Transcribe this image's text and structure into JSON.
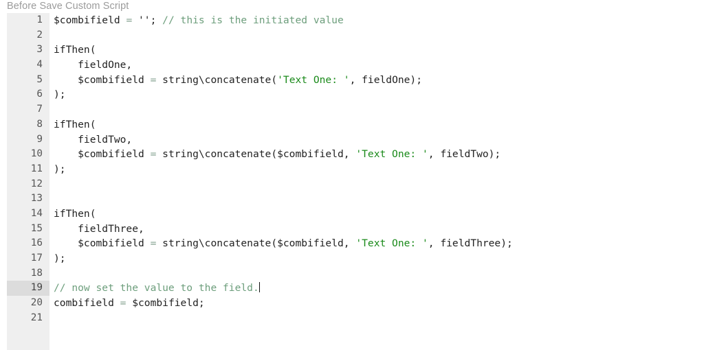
{
  "panel": {
    "title": "Before Save Custom Script"
  },
  "toolbar": {
    "add_label": "+",
    "add_icon": "plus-icon"
  },
  "editor": {
    "active_line": 19,
    "total_lines": 21,
    "colors": {
      "background": "#ffffff",
      "gutter": "#efefef",
      "gutter_active": "#dcdcdc",
      "text": "#222222",
      "comment": "#6d9e7c",
      "string": "#1a8a1a",
      "operator": "#7f9e8b",
      "title": "#9b9b9b"
    },
    "lines": [
      {
        "n": "1",
        "tokens": [
          {
            "t": "plain",
            "v": "$combifield "
          },
          {
            "t": "op",
            "v": "="
          },
          {
            "t": "plain",
            "v": " ''; "
          },
          {
            "t": "comment",
            "v": "// this is the initiated value"
          }
        ]
      },
      {
        "n": "2",
        "tokens": []
      },
      {
        "n": "3",
        "tokens": [
          {
            "t": "plain",
            "v": "ifThen("
          }
        ]
      },
      {
        "n": "4",
        "tokens": [
          {
            "t": "plain",
            "v": "    fieldOne,"
          }
        ]
      },
      {
        "n": "5",
        "tokens": [
          {
            "t": "plain",
            "v": "    $combifield "
          },
          {
            "t": "op",
            "v": "="
          },
          {
            "t": "plain",
            "v": " string\\concatenate("
          },
          {
            "t": "string",
            "v": "'Text One: '"
          },
          {
            "t": "plain",
            "v": ", fieldOne);"
          }
        ]
      },
      {
        "n": "6",
        "tokens": [
          {
            "t": "plain",
            "v": ");"
          }
        ]
      },
      {
        "n": "7",
        "tokens": []
      },
      {
        "n": "8",
        "tokens": [
          {
            "t": "plain",
            "v": "ifThen("
          }
        ]
      },
      {
        "n": "9",
        "tokens": [
          {
            "t": "plain",
            "v": "    fieldTwo,"
          }
        ]
      },
      {
        "n": "10",
        "tokens": [
          {
            "t": "plain",
            "v": "    $combifield "
          },
          {
            "t": "op",
            "v": "="
          },
          {
            "t": "plain",
            "v": " string\\concatenate($combifield, "
          },
          {
            "t": "string",
            "v": "'Text One: '"
          },
          {
            "t": "plain",
            "v": ", fieldTwo);"
          }
        ]
      },
      {
        "n": "11",
        "tokens": [
          {
            "t": "plain",
            "v": ");"
          }
        ]
      },
      {
        "n": "12",
        "tokens": []
      },
      {
        "n": "13",
        "tokens": []
      },
      {
        "n": "14",
        "tokens": [
          {
            "t": "plain",
            "v": "ifThen("
          }
        ]
      },
      {
        "n": "15",
        "tokens": [
          {
            "t": "plain",
            "v": "    fieldThree,"
          }
        ]
      },
      {
        "n": "16",
        "tokens": [
          {
            "t": "plain",
            "v": "    $combifield "
          },
          {
            "t": "op",
            "v": "="
          },
          {
            "t": "plain",
            "v": " string\\concatenate($combifield, "
          },
          {
            "t": "string",
            "v": "'Text One: '"
          },
          {
            "t": "plain",
            "v": ", fieldThree);"
          }
        ]
      },
      {
        "n": "17",
        "tokens": [
          {
            "t": "plain",
            "v": ");"
          }
        ]
      },
      {
        "n": "18",
        "tokens": []
      },
      {
        "n": "19",
        "tokens": [
          {
            "t": "comment",
            "v": "// now set the value to the field."
          }
        ],
        "caret": true
      },
      {
        "n": "20",
        "tokens": [
          {
            "t": "plain",
            "v": "combifield "
          },
          {
            "t": "op",
            "v": "="
          },
          {
            "t": "plain",
            "v": " $combifield;"
          }
        ]
      },
      {
        "n": "21",
        "tokens": []
      }
    ]
  }
}
